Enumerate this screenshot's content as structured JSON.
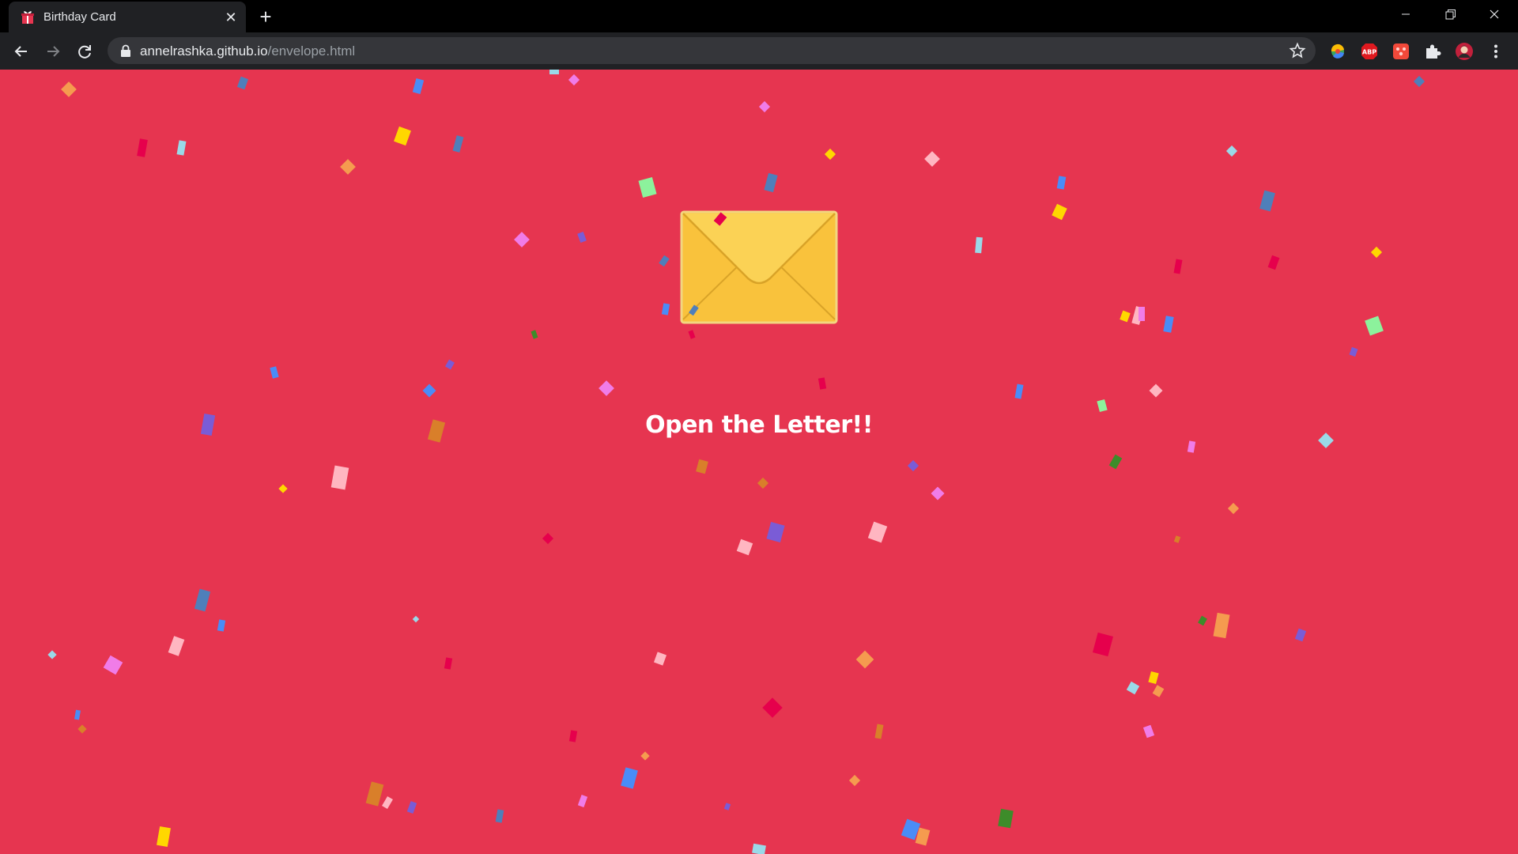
{
  "browser": {
    "tab": {
      "title": "Birthday Card",
      "favicon": "gift-box-icon"
    },
    "address": {
      "host": "annelrashka.github.io",
      "path": "/envelope.html"
    },
    "extensions": [
      "colorful-extension-icon",
      "abp-icon",
      "red-extension-icon",
      "puzzle-icon",
      "profile-avatar"
    ],
    "extension_labels": {
      "abp": "ABP"
    }
  },
  "page": {
    "background": "#e63550",
    "envelope_icon": "envelope-icon",
    "headline": "Open the Letter!!"
  },
  "colors": {
    "confetti": [
      "#f59b4f",
      "#ffd700",
      "#4a8cf7",
      "#e6004c",
      "#9ad9e8",
      "#8cf29c",
      "#f07ce8",
      "#7a5cd6",
      "#d97f2a",
      "#ffb6c1",
      "#3d8c2a",
      "#4f7fba"
    ]
  }
}
